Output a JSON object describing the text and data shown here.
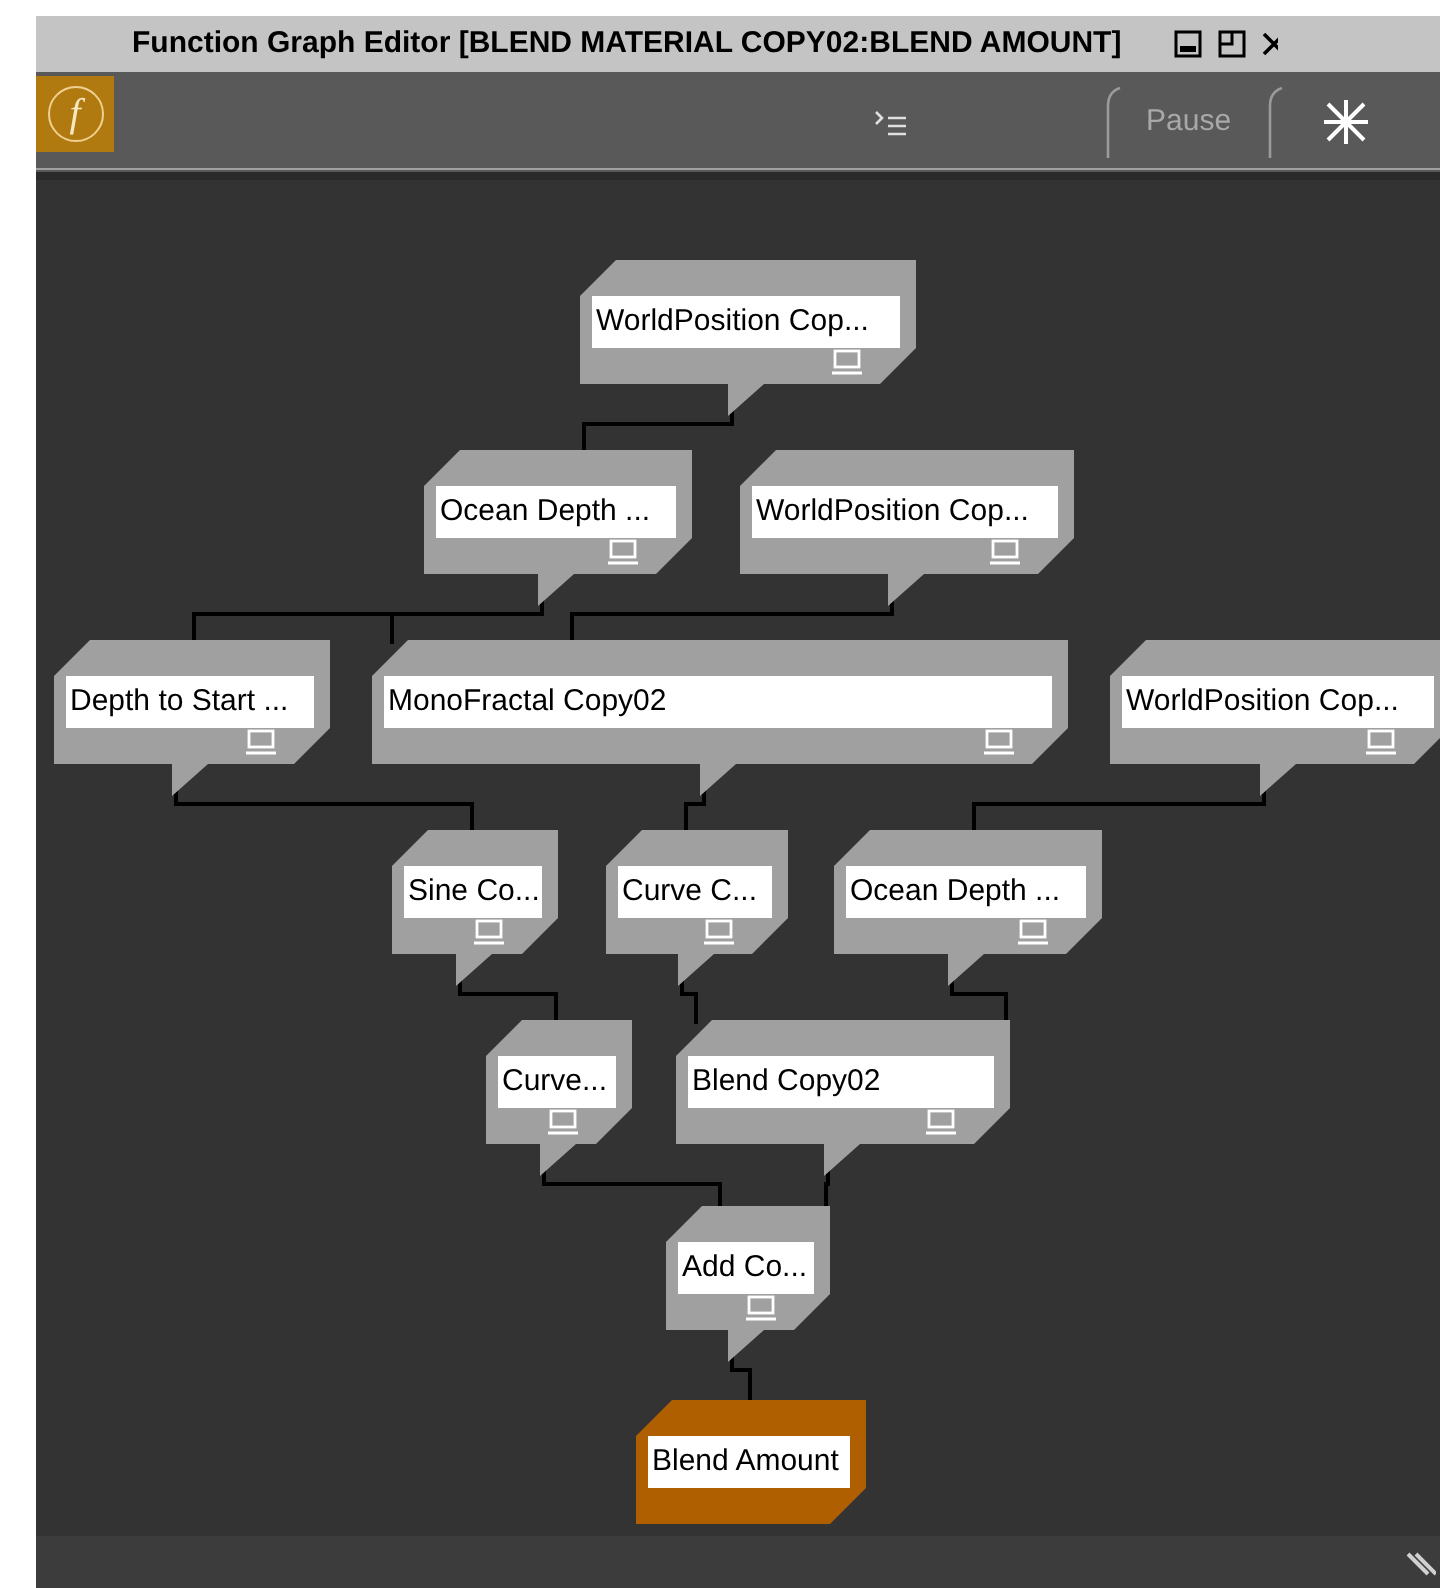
{
  "window": {
    "title": "Function Graph Editor [BLEND MATERIAL COPY02:BLEND AMOUNT]"
  },
  "toolbar": {
    "logo": "f",
    "pause_button": "Pause"
  },
  "nodes": [
    {
      "label": "WorldPosition Cop...",
      "kind": "function",
      "selected": false
    },
    {
      "label": "Ocean Depth ...",
      "kind": "function",
      "selected": false
    },
    {
      "label": "WorldPosition Cop...",
      "kind": "function",
      "selected": false
    },
    {
      "label": "Depth to Start ...",
      "kind": "function",
      "selected": false
    },
    {
      "label": "MonoFractal Copy02",
      "kind": "function",
      "selected": false
    },
    {
      "label": "WorldPosition Cop...",
      "kind": "function",
      "selected": false
    },
    {
      "label": "Sine Co...",
      "kind": "function",
      "selected": false
    },
    {
      "label": "Curve C...",
      "kind": "function",
      "selected": false
    },
    {
      "label": "Ocean Depth ...",
      "kind": "function",
      "selected": false
    },
    {
      "label": "Curve...",
      "kind": "function",
      "selected": false
    },
    {
      "label": "Blend Copy02",
      "kind": "function",
      "selected": false
    },
    {
      "label": "Add Co...",
      "kind": "function",
      "selected": false
    },
    {
      "label": "Blend Amount",
      "kind": "output",
      "selected": true
    }
  ]
}
